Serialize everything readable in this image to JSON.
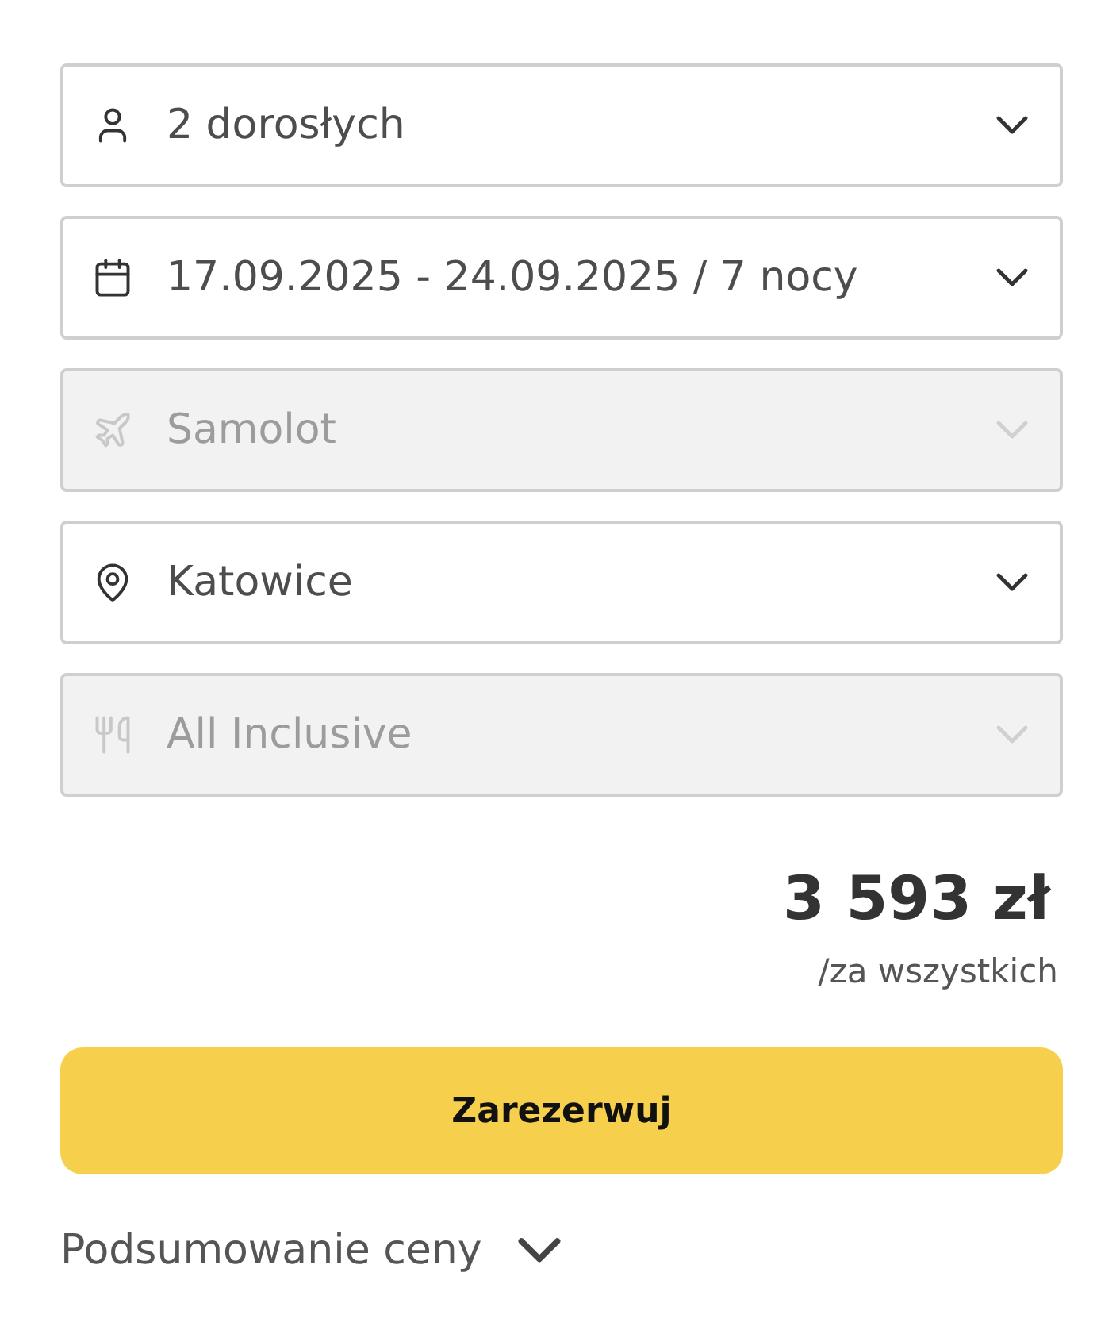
{
  "fields": [
    {
      "kind": "travelers",
      "value": "2 dorosłych",
      "disabled": false
    },
    {
      "kind": "dates",
      "value": "17.09.2025 - 24.09.2025 / 7 nocy",
      "disabled": false
    },
    {
      "kind": "transport",
      "value": "Samolot",
      "disabled": true
    },
    {
      "kind": "departure",
      "value": "Katowice",
      "disabled": false
    },
    {
      "kind": "board",
      "value": "All Inclusive",
      "disabled": true
    }
  ],
  "price": {
    "amount": "3 593 zł",
    "note": "/za wszystkich"
  },
  "book_button": {
    "label": "Zarezerwuj"
  },
  "price_summary": {
    "label": "Podsumowanie ceny",
    "expanded": false
  }
}
